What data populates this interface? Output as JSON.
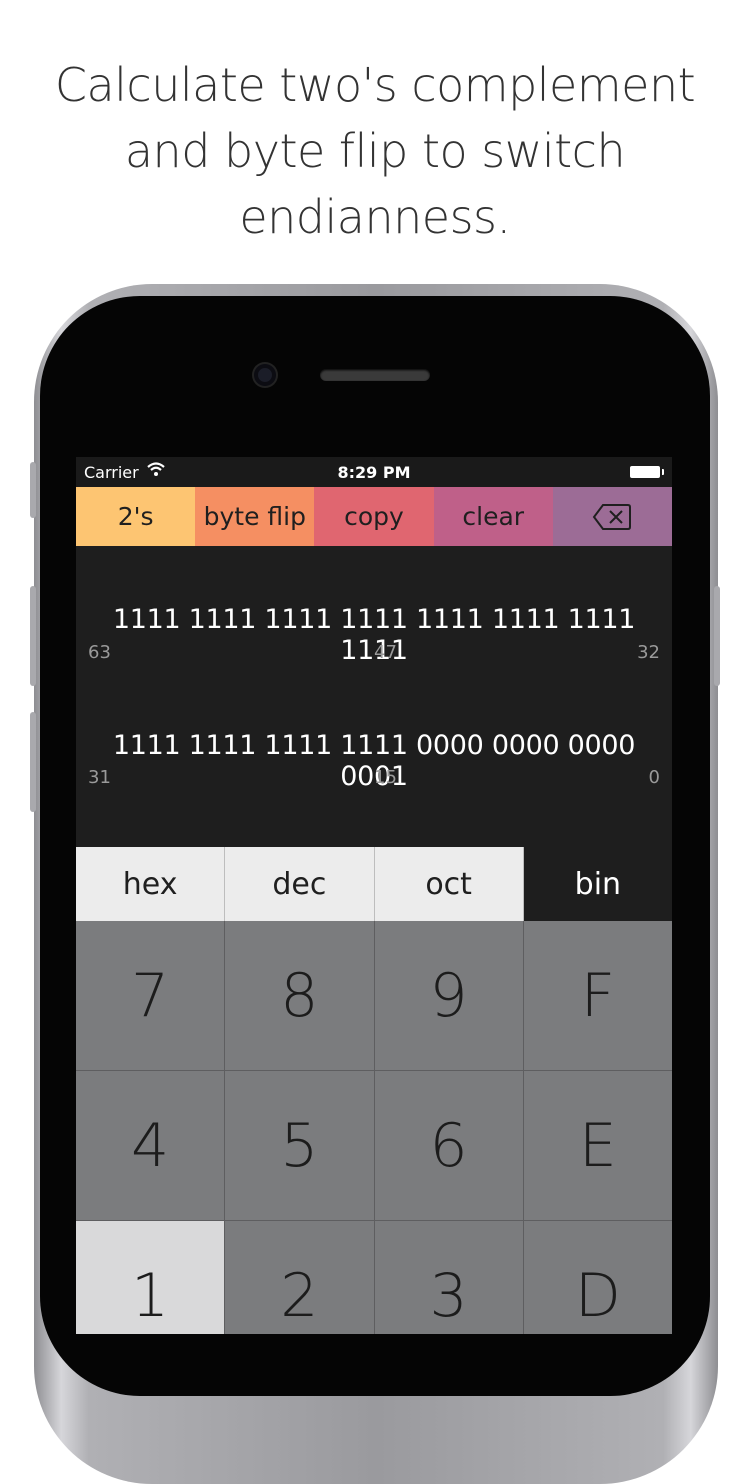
{
  "headline": {
    "line1": "Calculate two's complement",
    "line2": "and byte flip to switch",
    "line3": "endianness."
  },
  "status_bar": {
    "carrier": "Carrier",
    "time": "8:29 PM",
    "icons": [
      "wifi-icon",
      "battery-icon"
    ]
  },
  "toolbar": {
    "twos": "2's",
    "byte_flip": "byte flip",
    "copy": "copy",
    "clear": "clear",
    "backspace_icon": "backspace-icon",
    "colors": {
      "twos": "#fdc572",
      "byte_flip": "#f58f62",
      "copy": "#e06670",
      "clear": "#bf6089",
      "backspace": "#9c6c96"
    }
  },
  "display": {
    "rows": [
      {
        "value": "1111 1111 1111 1111 1111 1111 1111 1111",
        "left": "63",
        "mid": "47",
        "right": "32"
      },
      {
        "value": "1111 1111 1111 1111 0000 0000 0000 0001",
        "left": "31",
        "mid": "15",
        "right": "0"
      }
    ]
  },
  "bases": {
    "items": [
      "hex",
      "dec",
      "oct",
      "bin"
    ],
    "selected": "bin"
  },
  "keypad": {
    "keys": [
      "7",
      "8",
      "9",
      "F",
      "4",
      "5",
      "6",
      "E",
      "1",
      "2",
      "3",
      "D"
    ]
  }
}
